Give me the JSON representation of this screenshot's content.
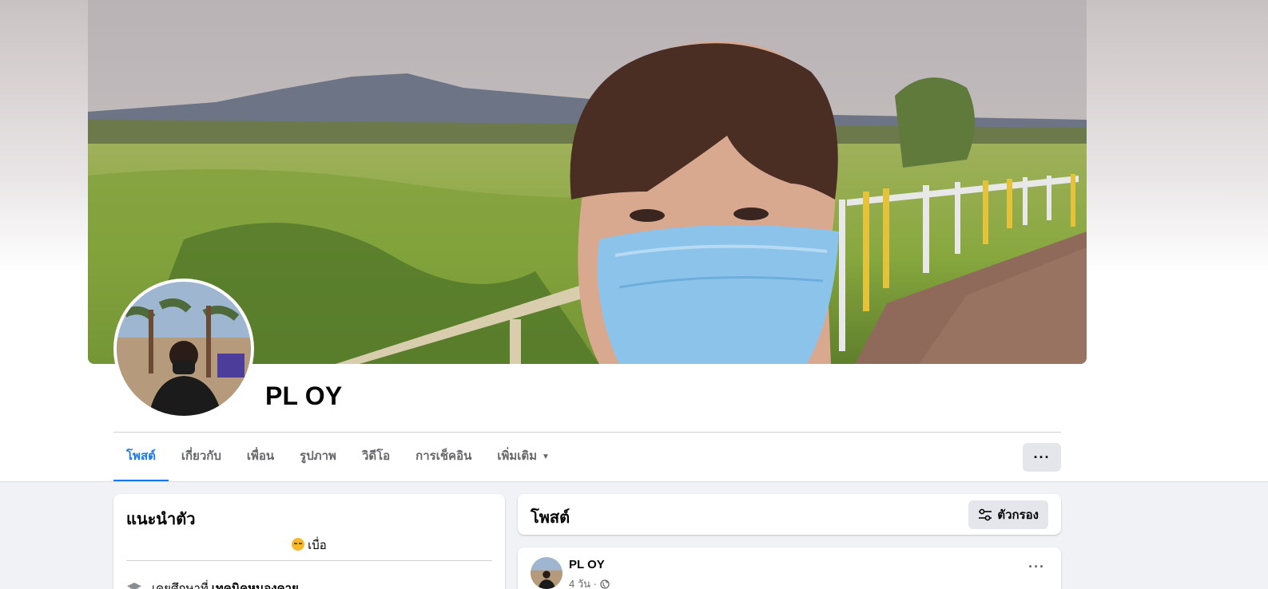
{
  "profile": {
    "name": "PL OY"
  },
  "tabs": [
    {
      "label": "โพสต์",
      "active": true
    },
    {
      "label": "เกี่ยวกับ",
      "active": false
    },
    {
      "label": "เพื่อน",
      "active": false
    },
    {
      "label": "รูปภาพ",
      "active": false
    },
    {
      "label": "วิดีโอ",
      "active": false
    },
    {
      "label": "การเช็คอิน",
      "active": false
    },
    {
      "label": "เพิ่มเติม",
      "active": false
    }
  ],
  "more_button": {
    "icon": "more-horizontal-icon",
    "label": "···"
  },
  "intro": {
    "title": "แนะนำตัว",
    "bio": "เบื่อ",
    "education_prefix": "เคยศึกษาที่",
    "education_school": "เทคนิคหนองคาย"
  },
  "posts_section": {
    "title": "โพสต์",
    "filter_label": "ตัวกรอง"
  },
  "post": {
    "author": "PL OY",
    "time": "4 วัน ·",
    "dots": "···"
  },
  "colors": {
    "accent": "#1877f2",
    "page_bg": "#f0f2f5",
    "button_bg": "#e4e6eb",
    "secondary_text": "#65676b"
  }
}
